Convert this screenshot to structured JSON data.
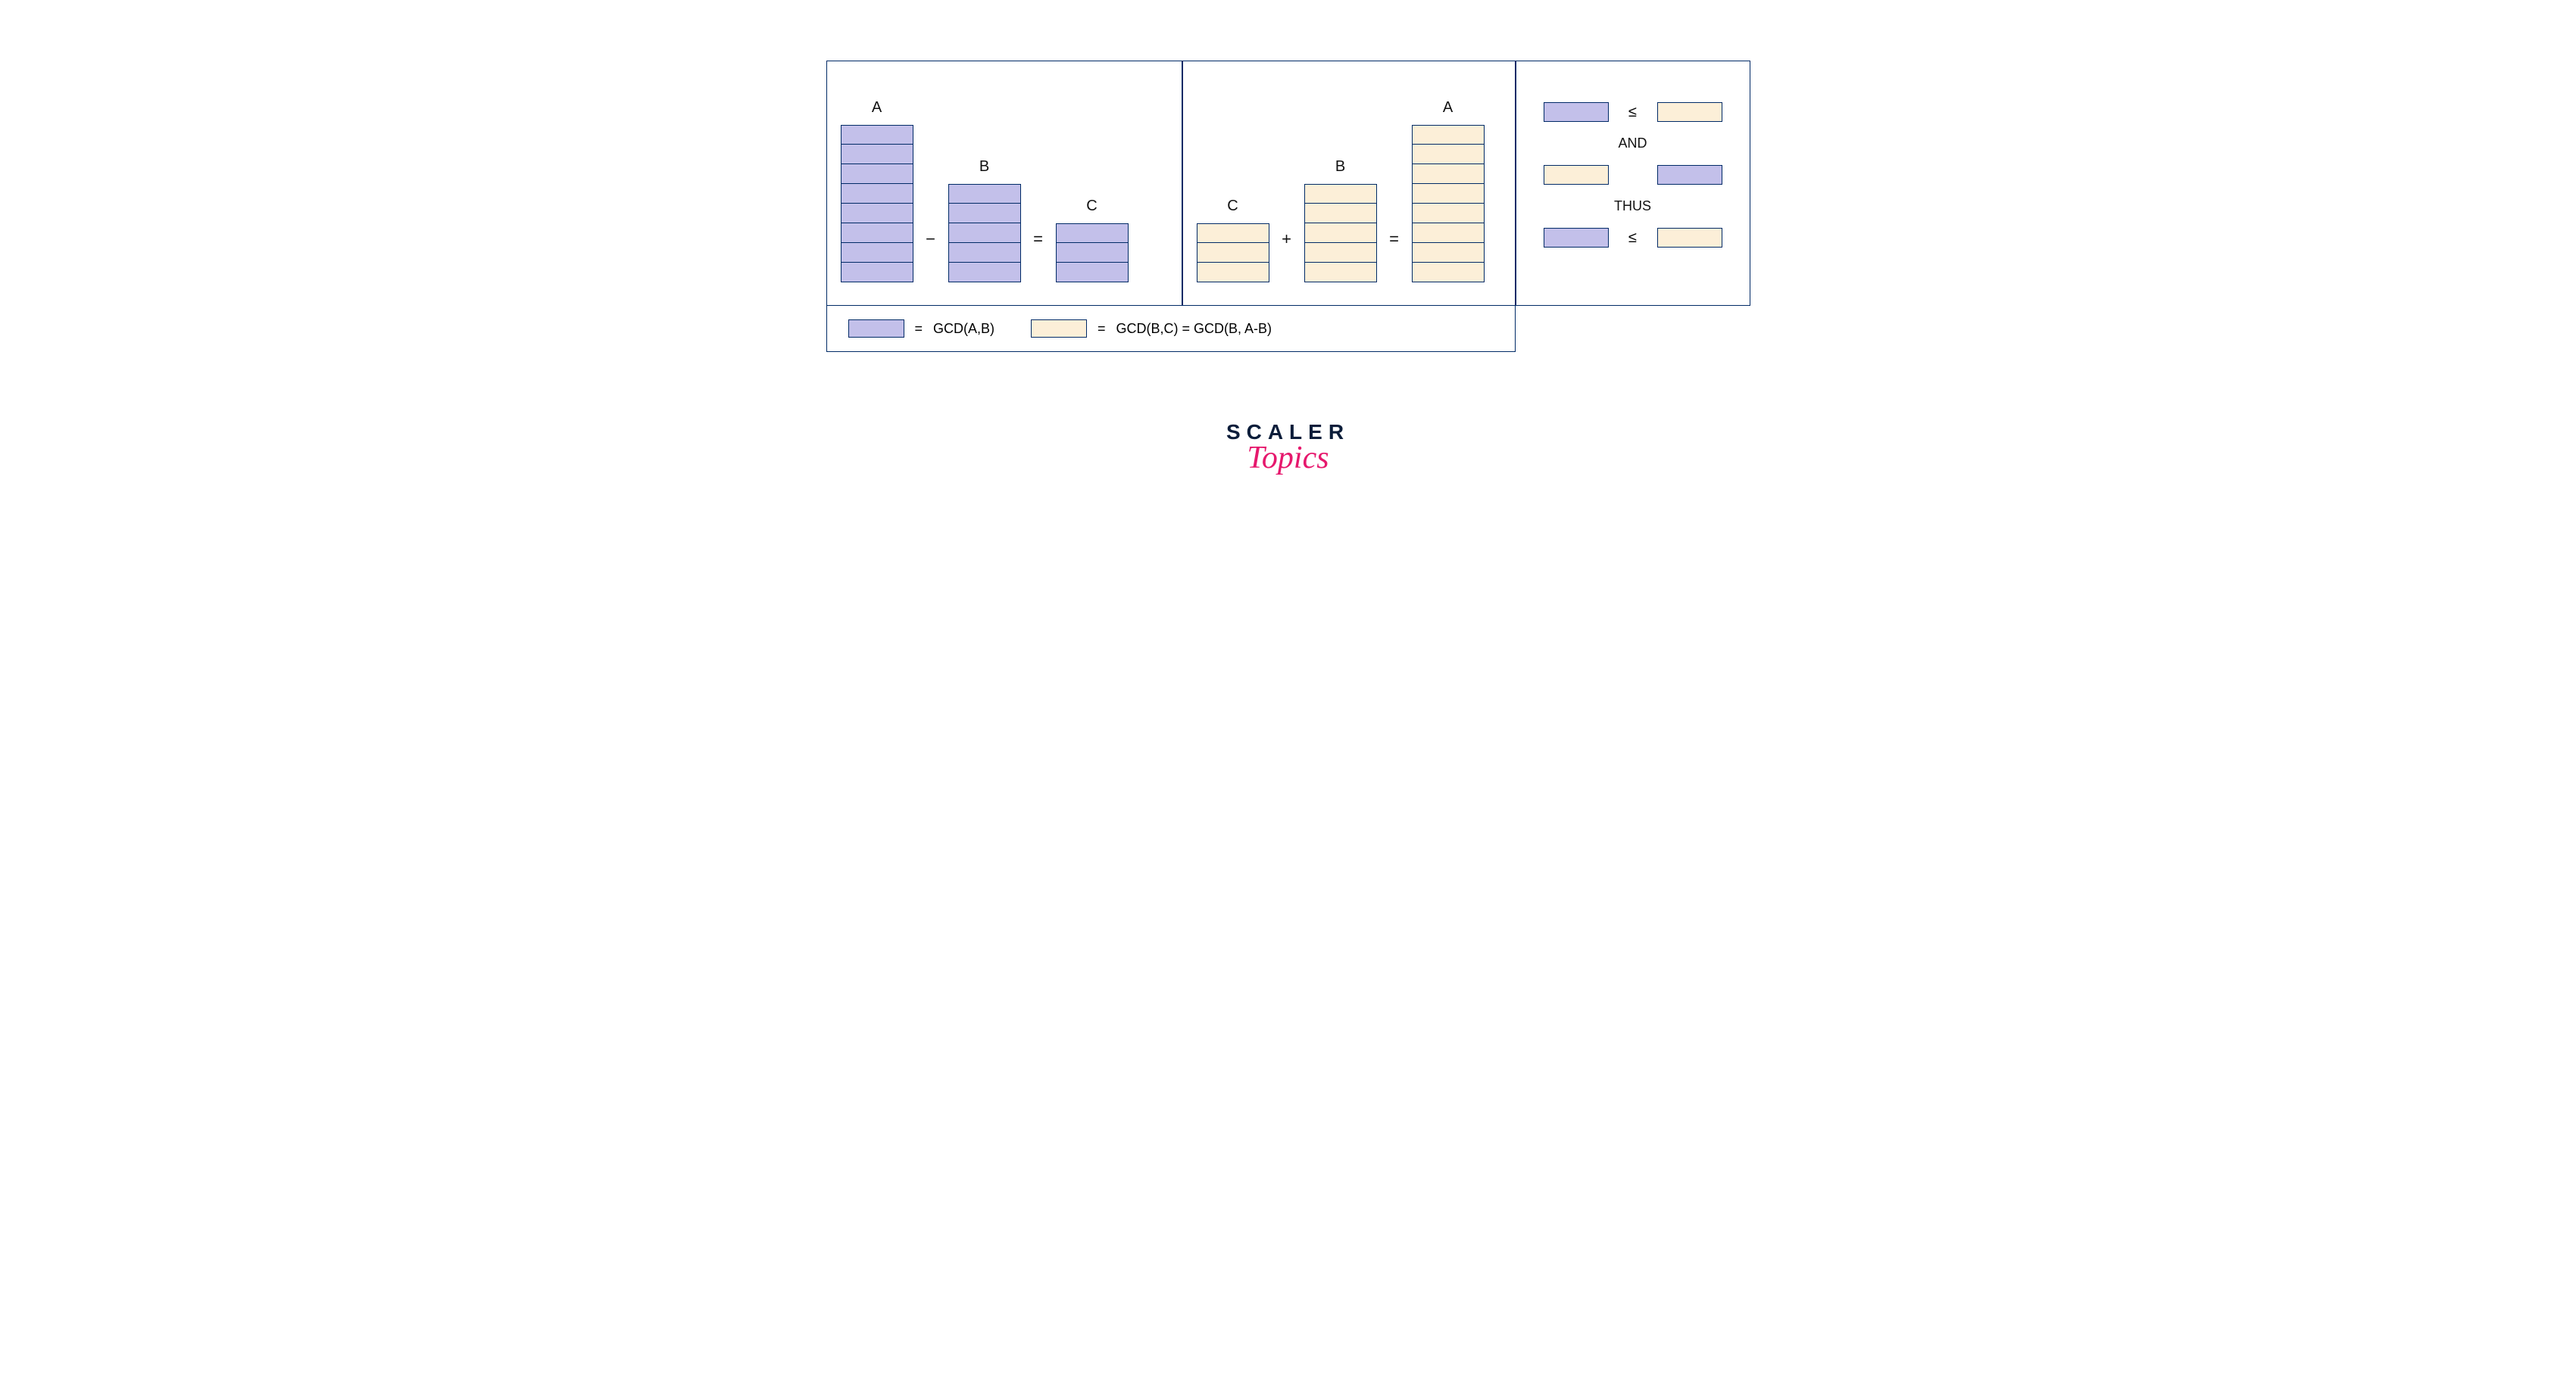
{
  "panel1": {
    "labels": {
      "a": "A",
      "b": "B",
      "c": "C"
    },
    "ops": {
      "minus": "−",
      "equals": "="
    },
    "stacks": {
      "a": 8,
      "b": 5,
      "c": 3
    },
    "color": "purple"
  },
  "panel2": {
    "labels": {
      "c": "C",
      "b": "B",
      "a": "A"
    },
    "ops": {
      "plus": "+",
      "equals": "="
    },
    "stacks": {
      "c": 3,
      "b": 5,
      "a": 8
    },
    "color": "cream"
  },
  "panel3": {
    "rows": [
      {
        "left": "purple",
        "rel": "≤",
        "right": "cream"
      },
      {
        "word": "AND"
      },
      {
        "left": "cream",
        "rel": "",
        "right": "purple"
      },
      {
        "word": "THUS"
      },
      {
        "left": "purple",
        "rel": "≤",
        "right": "cream"
      }
    ]
  },
  "legend": {
    "item1": {
      "color": "purple",
      "eq": "=",
      "text": "GCD(A,B)"
    },
    "item2": {
      "color": "cream",
      "eq": "=",
      "text": "GCD(B,C) = GCD(B, A-B)"
    }
  },
  "logo": {
    "line1": "SCALER",
    "line2": "Topics"
  }
}
